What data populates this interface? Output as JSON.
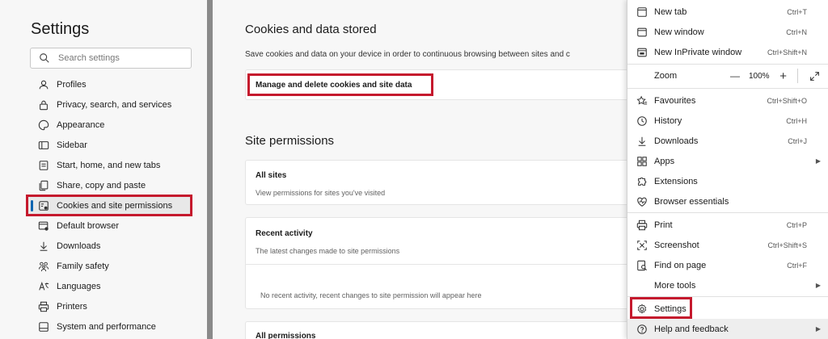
{
  "nav": {
    "title": "Settings",
    "search_placeholder": "Search settings",
    "items": [
      {
        "label": "Profiles",
        "icon": "profile-icon"
      },
      {
        "label": "Privacy, search, and services",
        "icon": "lock-icon"
      },
      {
        "label": "Appearance",
        "icon": "appearance-icon"
      },
      {
        "label": "Sidebar",
        "icon": "sidebar-icon"
      },
      {
        "label": "Start, home, and new tabs",
        "icon": "home-icon"
      },
      {
        "label": "Share, copy and paste",
        "icon": "share-icon"
      },
      {
        "label": "Cookies and site permissions",
        "icon": "cookie-icon",
        "active": true
      },
      {
        "label": "Default browser",
        "icon": "browser-icon"
      },
      {
        "label": "Downloads",
        "icon": "download-icon"
      },
      {
        "label": "Family safety",
        "icon": "family-icon"
      },
      {
        "label": "Languages",
        "icon": "language-icon"
      },
      {
        "label": "Printers",
        "icon": "printer-icon"
      },
      {
        "label": "System and performance",
        "icon": "system-icon"
      }
    ]
  },
  "main": {
    "cookies_title": "Cookies and data stored",
    "cookies_desc": "Save cookies and data on your device in order to continuous browsing between sites and c",
    "manage_label": "Manage and delete cookies and site data",
    "permissions_title": "Site permissions",
    "all_sites_title": "All sites",
    "all_sites_desc": "View permissions for sites you've visited",
    "recent_title": "Recent activity",
    "recent_desc": "The latest changes made to site permissions",
    "recent_empty": "No recent activity, recent changes to site permission will appear here",
    "all_permissions_title": "All permissions"
  },
  "menu": {
    "new_tab": {
      "label": "New tab",
      "shortcut": "Ctrl+T"
    },
    "new_window": {
      "label": "New window",
      "shortcut": "Ctrl+N"
    },
    "inprivate": {
      "label": "New InPrivate window",
      "shortcut": "Ctrl+Shift+N"
    },
    "zoom": {
      "label": "Zoom",
      "value": "100%",
      "minus": "—",
      "plus": "+"
    },
    "favourites": {
      "label": "Favourites",
      "shortcut": "Ctrl+Shift+O"
    },
    "history": {
      "label": "History",
      "shortcut": "Ctrl+H"
    },
    "downloads": {
      "label": "Downloads",
      "shortcut": "Ctrl+J"
    },
    "apps": {
      "label": "Apps"
    },
    "extensions": {
      "label": "Extensions"
    },
    "essentials": {
      "label": "Browser essentials"
    },
    "print": {
      "label": "Print",
      "shortcut": "Ctrl+P"
    },
    "screenshot": {
      "label": "Screenshot",
      "shortcut": "Ctrl+Shift+S"
    },
    "find": {
      "label": "Find on page",
      "shortcut": "Ctrl+F"
    },
    "more_tools": {
      "label": "More tools"
    },
    "settings": {
      "label": "Settings"
    },
    "help": {
      "label": "Help and feedback"
    }
  },
  "colors": {
    "highlight": "#c5192d",
    "accent": "#0f6cbd"
  }
}
